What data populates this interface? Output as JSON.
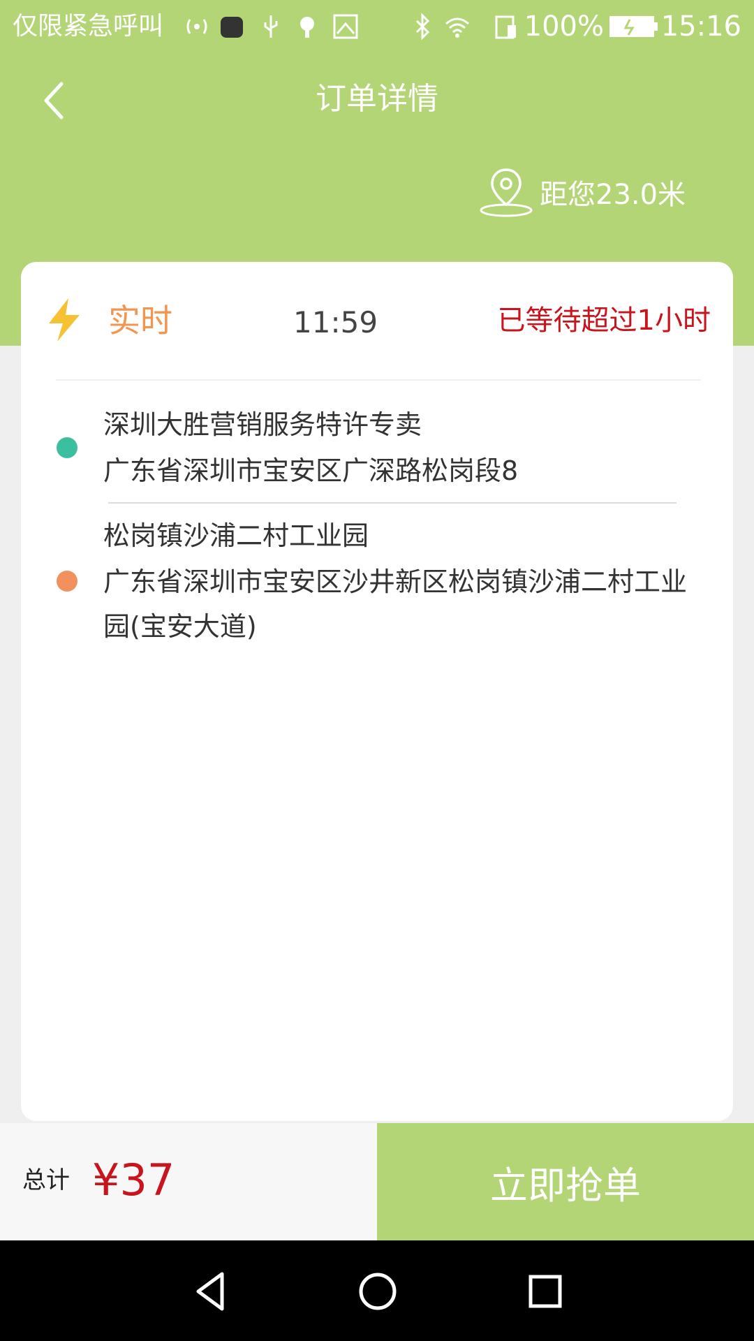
{
  "status_bar": {
    "carrier": "仅限紧急呼叫",
    "battery": "100%",
    "time": "15:16",
    "icons": [
      "signal-icon",
      "app-icon",
      "usb-icon",
      "android-icon",
      "image-icon",
      "bluetooth-icon",
      "wifi-icon",
      "sim-icon",
      "battery-icon"
    ]
  },
  "header": {
    "title": "订单详情",
    "distance": "距您23.0米",
    "back_icon": "chevron-left-icon",
    "location_icon": "location-pin-icon"
  },
  "order": {
    "type": "实时",
    "time": "11:59",
    "waiting": "已等待超过1小时",
    "start": {
      "name": "深圳大胜营销服务特许专卖",
      "address": "广东省深圳市宝安区广深路松岗段8"
    },
    "end": {
      "name": "松岗镇沙浦二村工业园",
      "address": "广东省深圳市宝安区沙井新区松岗镇沙浦二村工业园(宝安大道)"
    }
  },
  "footer": {
    "total_label": "总计",
    "price": "¥37",
    "grab_button": "立即抢单"
  },
  "colors": {
    "header_green": "#b3d576",
    "price_red": "#c8141c",
    "start_dot": "#3cbfa0",
    "end_dot": "#f3905f",
    "type_orange": "#f3954f"
  }
}
